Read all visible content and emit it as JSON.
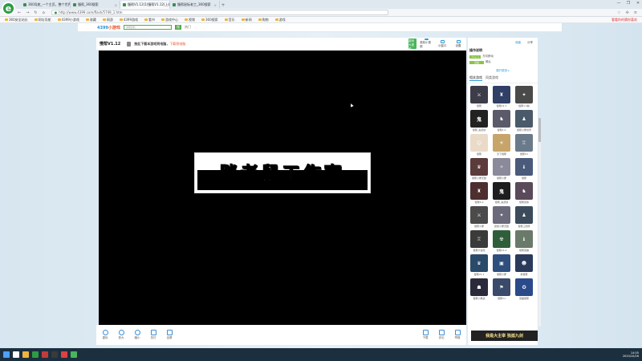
{
  "browser": {
    "logo": "e",
    "tabs": [
      {
        "title": "360导航_一个主页，整个世界",
        "active": false
      },
      {
        "title": "慢帮_360搜索",
        "active": false
      },
      {
        "title": "慢帮V1.12(1)慢帮V1.12(上线)v1.12...",
        "active": true
      },
      {
        "title": "慢帮鼠标老工_360搜索",
        "active": false
      }
    ],
    "new_tab": "+",
    "window_controls": [
      "—",
      "❐",
      "✕"
    ],
    "nav": {
      "back": "←",
      "forward": "→",
      "refresh": "↻",
      "home": "⌂"
    },
    "address": "http://www.4399.com/flash/5749_1.htm",
    "bookmarks": [
      "360安全站长",
      "网址导航",
      "4399小游戏",
      "收藏",
      "网游",
      "4399游戏",
      "看书",
      "游戏中心",
      "视频",
      "360搜索",
      "音乐",
      "新闻",
      "购物",
      "游戏"
    ],
    "bookmarks_right": "看看你的猜你喜欢"
  },
  "site": {
    "brand_num": "4399",
    "brand_text": "小游戏",
    "search_placeholder": "请搜索",
    "search_btn": "搜",
    "hot_label": "热门"
  },
  "game": {
    "title": "慢帮V1.12",
    "tip": "按此下载本游戏到电脑，",
    "tip_link": "下载到电脑",
    "tools": [
      {
        "label": "游戏大视频",
        "green": true
      },
      {
        "label": "录制小视频",
        "green": false
      },
      {
        "label": "小窗口",
        "green": false
      },
      {
        "label": "设置",
        "green": false
      }
    ],
    "banner_text": "胖老鼠工作室",
    "bottom_left": [
      "重玩",
      "放大",
      "缩小",
      "关灯",
      "全屏"
    ],
    "bottom_right": [
      "下载",
      "评论",
      "举报"
    ]
  },
  "side": {
    "top_links": [
      "收藏",
      "分享"
    ],
    "ops_title": "操作说明",
    "ops_rows": [
      {
        "key": "↑↓←→",
        "desc": "方向移动"
      },
      {
        "key": "空格",
        "desc": "确认"
      }
    ],
    "more": "展开更多∨",
    "tabs": [
      "相关游戏",
      "同类游戏"
    ],
    "games": [
      {
        "name": "慢帮",
        "color": "#3d3d4a",
        "glyph": "⚔"
      },
      {
        "name": "慢帮V1.1",
        "color": "#2f3f66",
        "glyph": "♜"
      },
      {
        "name": "慢帮1.0版",
        "color": "#4a4a4a",
        "glyph": "✦"
      },
      {
        "name": "慢帮_鬼武侠",
        "color": "#222222",
        "glyph": "鬼"
      },
      {
        "name": "慢帮1.0",
        "color": "#5a5a6a",
        "glyph": "♞"
      },
      {
        "name": "慢帮小屋世界",
        "color": "#4a5a6a",
        "glyph": "♟"
      },
      {
        "name": "慢帮",
        "color": "#e9dbc8",
        "glyph": "☺"
      },
      {
        "name": "天下慢帮",
        "color": "#c7a46a",
        "glyph": "☀"
      },
      {
        "name": "慢帮V1",
        "color": "#6a7a8a",
        "glyph": "♖"
      },
      {
        "name": "慢帮小屋无敌",
        "color": "#5b3b3b",
        "glyph": "♛"
      },
      {
        "name": "慢帮小屋",
        "color": "#8a8a9a",
        "glyph": "✧"
      },
      {
        "name": "慢帮",
        "color": "#4a5a7a",
        "glyph": "♝"
      },
      {
        "name": "慢帮4.0",
        "color": "#4d2f2f",
        "glyph": "♜"
      },
      {
        "name": "慢帮_鬼武侠",
        "color": "#1e1e1e",
        "glyph": "鬼"
      },
      {
        "name": "慢帮武侠",
        "color": "#5a4a5a",
        "glyph": "♞"
      },
      {
        "name": "慢帮小屋",
        "color": "#4b4b4b",
        "glyph": "⚔"
      },
      {
        "name": "鼠鼠小屋无敌",
        "color": "#6a6a7a",
        "glyph": "✦"
      },
      {
        "name": "慢帮三国传",
        "color": "#3b4b5b",
        "glyph": "♟"
      },
      {
        "name": "慢帮大冒险",
        "color": "#3b3b3b",
        "glyph": "♖"
      },
      {
        "name": "慢帮V1.0",
        "color": "#2f5f3a",
        "glyph": "☢"
      },
      {
        "name": "慢帮英雄",
        "color": "#6a7a6a",
        "glyph": "♝"
      },
      {
        "name": "慢帮V1.1",
        "color": "#2a4a6a",
        "glyph": "♛"
      },
      {
        "name": "慢帮小屋",
        "color": "#2e4e7e",
        "glyph": "▣"
      },
      {
        "name": "新慢帮",
        "color": "#2a3a5a",
        "glyph": "☻"
      },
      {
        "name": "慢帮小屋战",
        "color": "#2a2a3a",
        "glyph": "☗"
      },
      {
        "name": "慢帮V1",
        "color": "#3a4a6a",
        "glyph": "⚑"
      },
      {
        "name": "英雄慢帮",
        "color": "#2a4a8a",
        "glyph": "✪"
      }
    ],
    "ad_text": "我是大主宰 独孤九剑"
  },
  "taskbar": {
    "icons": [
      "#4ea1ff",
      "#ffffff",
      "#f0b43c",
      "#2e9b45",
      "#c23a3a",
      "#3a3a3a",
      "#e04040",
      "#4ab45b"
    ],
    "time": "14:05",
    "date": "2020/10/26"
  }
}
